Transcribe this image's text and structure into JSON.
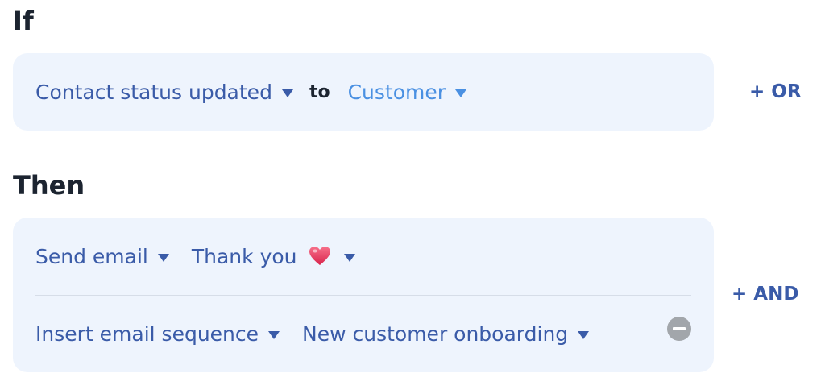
{
  "if_section": {
    "heading": "If",
    "trigger": {
      "label": "Contact status updated"
    },
    "connector": "to",
    "value": {
      "label": "Customer"
    },
    "or_button": "+ OR"
  },
  "then_section": {
    "heading": "Then",
    "actions": [
      {
        "action": "Send email",
        "target": "Thank you",
        "target_icon": "heart-icon"
      },
      {
        "action": "Insert email sequence",
        "target": "New customer onboarding"
      }
    ],
    "and_button": "+ AND"
  },
  "colors": {
    "panel_bg": "#eef4fd",
    "accent": "#3a5ba8",
    "selected_value": "#4a90e2",
    "heading": "#1c2430",
    "remove": "#a2a6ab",
    "heart": "#e8385e"
  }
}
